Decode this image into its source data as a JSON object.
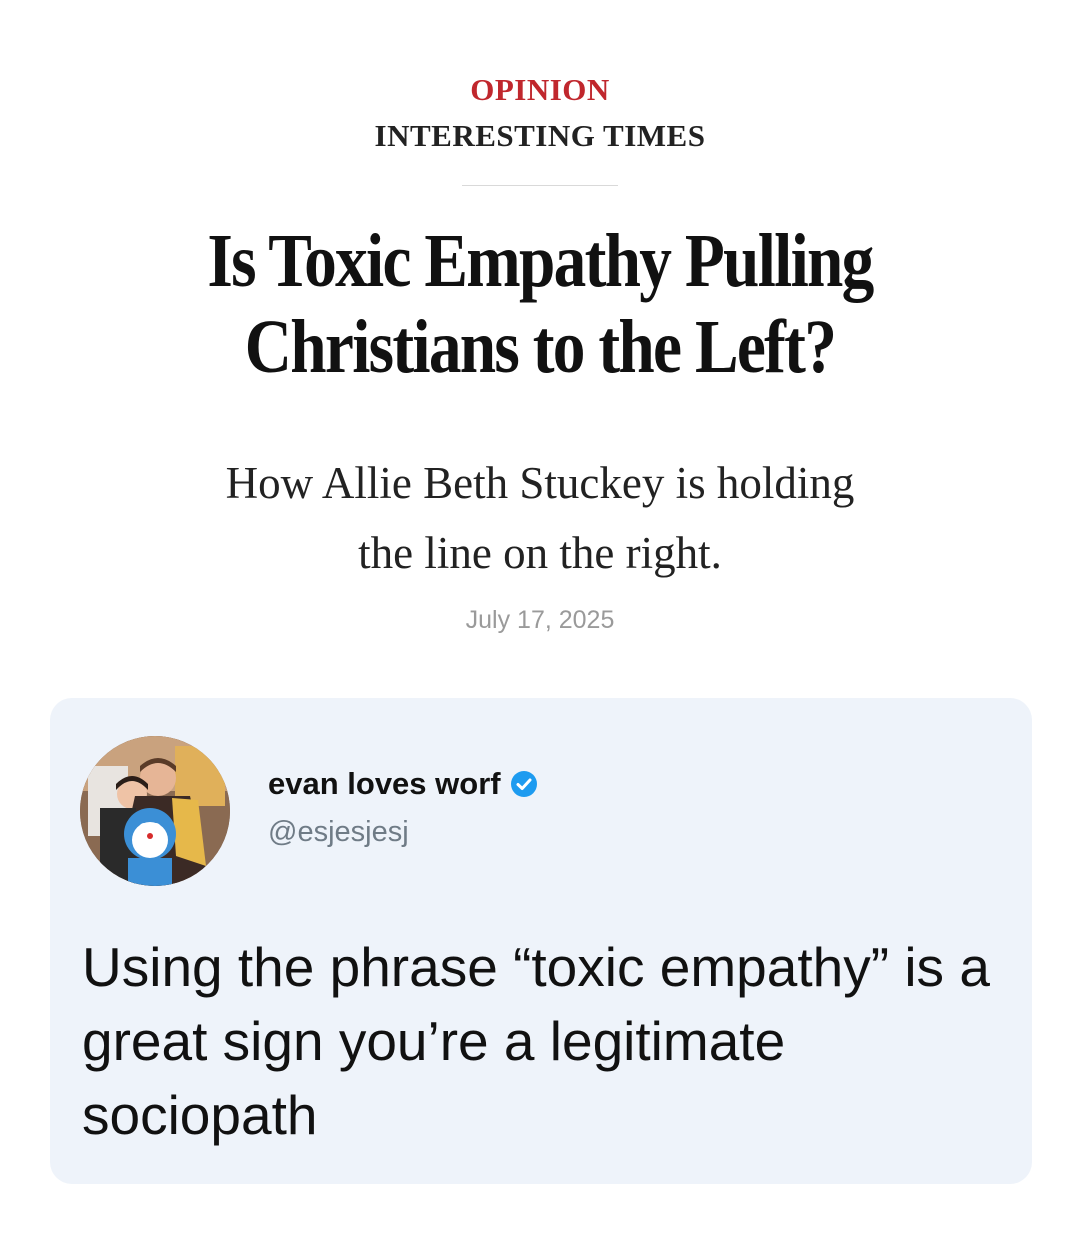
{
  "article": {
    "section": "OPINION",
    "column": "INTERESTING TIMES",
    "headline_line1": "Is Toxic Empathy Pulling",
    "headline_line2": "Christians to the Left?",
    "dek_line1": "How Allie Beth Stuckey is holding",
    "dek_line2": "the line on the right.",
    "date": "July 17, 2025"
  },
  "tweet": {
    "display_name": "evan loves worf",
    "handle": "@esjesjesj",
    "verified": true,
    "verified_badge_icon": "verified-check-icon",
    "avatar_icon": "profile-photo",
    "text": "Using the phrase “toxic empathy” is a great sign you’re a legitimate sociopath"
  },
  "colors": {
    "section_label": "#c0272d",
    "tweet_background": "#eef3fa",
    "verified_badge": "#1d9bf0",
    "handle": "#6f7b86",
    "date": "#9a9a9a"
  }
}
